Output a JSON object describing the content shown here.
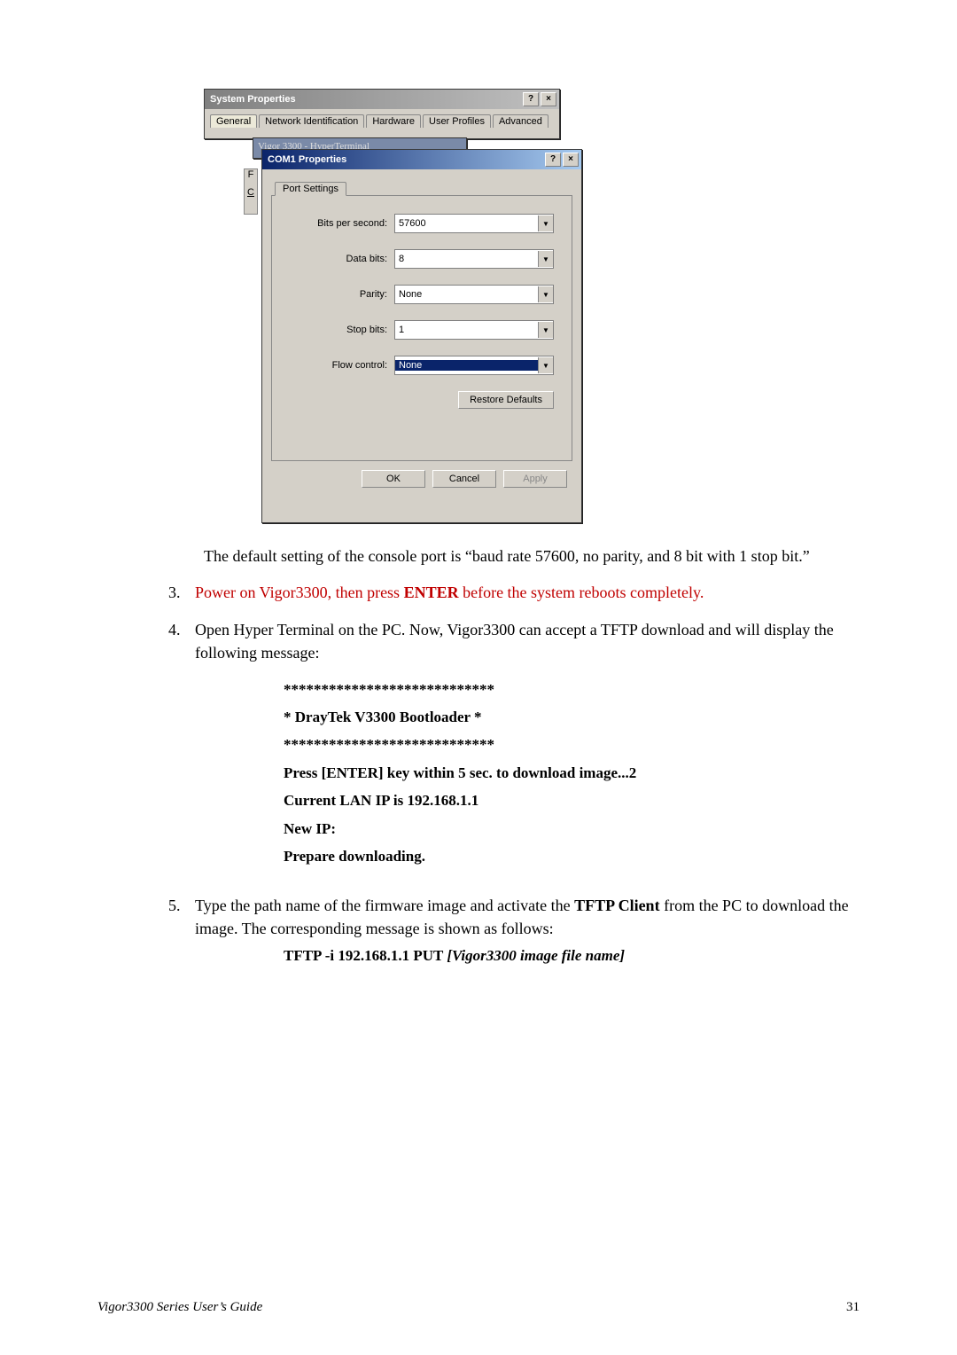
{
  "sysprops": {
    "title": "System Properties",
    "help_btn": "?",
    "close_btn": "×",
    "tabs": {
      "general": "General",
      "network": "Network Identification",
      "hardware": "Hardware",
      "userprofiles": "User Profiles",
      "advanced": "Advanced"
    }
  },
  "hyperterm": {
    "title": "Vigor 3300 - HyperTerminal"
  },
  "com": {
    "title": "COM1 Properties",
    "help_btn": "?",
    "close_btn": "×",
    "tab": "Port Settings",
    "labels": {
      "bps": "Bits per second:",
      "databits": "Data bits:",
      "parity": "Parity:",
      "stopbits": "Stop bits:",
      "flow": "Flow control:"
    },
    "values": {
      "bps": "57600",
      "databits": "8",
      "parity": "None",
      "stopbits": "1",
      "flow": "None"
    },
    "restore": "Restore Defaults",
    "ok": "OK",
    "cancel": "Cancel",
    "apply": "Apply"
  },
  "side_letter_f": "F",
  "side_letter_c": "C",
  "doc": {
    "caption": "The default setting of the console port is “baud rate 57600, no parity, and 8 bit with 1 stop bit.”",
    "step3_num": "3.",
    "step3_a": "Power on Vigor3300, then press ",
    "step3_b": "ENTER",
    "step3_c": " before the system reboots completely.",
    "step4_num": "4.",
    "step4_text": "Open Hyper Terminal on the PC. Now, Vigor3300 can accept a TFTP download and will display the following message:",
    "console": {
      "line1": "****************************",
      "line2": "* DrayTek V3300 Bootloader *",
      "line3": "****************************",
      "line4": "Press [ENTER] key within 5 sec. to download image...2",
      "line5": "Current LAN IP is 192.168.1.1",
      "line6": "New IP:",
      "line7": "Prepare downloading."
    },
    "step5_num": "5.",
    "step5_a": "Type the path name of the firmware image and activate the ",
    "step5_b": "TFTP Client",
    "step5_c": " from the PC to download the image. The corresponding message is shown as follows:",
    "tftp_a": "TFTP -i 192.168.1.1 PUT ",
    "tftp_b": "[Vigor3300 image file name]"
  },
  "footer": {
    "guide": "Vigor3300 Series User’s Guide",
    "page": "31"
  }
}
